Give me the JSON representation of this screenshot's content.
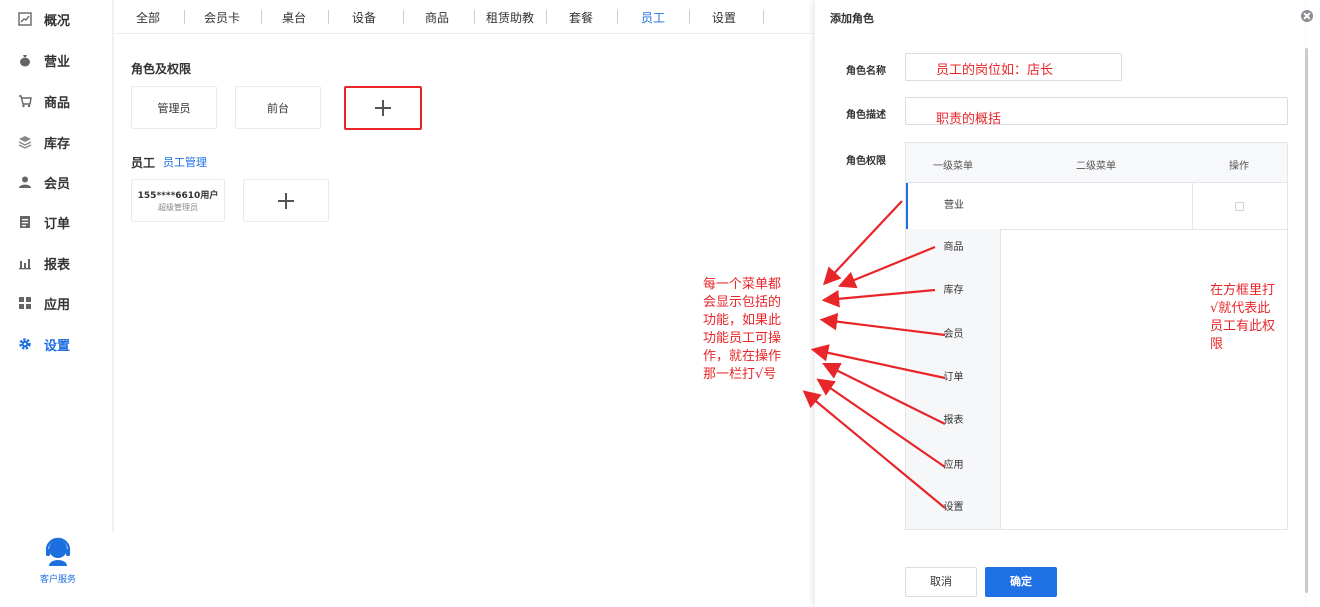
{
  "sidebar": {
    "items": [
      {
        "label": "概况",
        "icon": "chart-line-icon"
      },
      {
        "label": "营业",
        "icon": "money-bag-icon"
      },
      {
        "label": "商品",
        "icon": "cart-icon"
      },
      {
        "label": "库存",
        "icon": "stack-icon"
      },
      {
        "label": "会员",
        "icon": "user-icon"
      },
      {
        "label": "订单",
        "icon": "order-icon"
      },
      {
        "label": "报表",
        "icon": "bar-chart-icon"
      },
      {
        "label": "应用",
        "icon": "grid-icon"
      },
      {
        "label": "设置",
        "icon": "gear-icon",
        "active": true
      }
    ],
    "customer_service": "客户服务"
  },
  "tabs": [
    "全部",
    "会员卡",
    "桌台",
    "设备",
    "商品",
    "租赁助教",
    "套餐",
    "员工",
    "设置"
  ],
  "active_tab": "员工",
  "main": {
    "roles_title": "角色及权限",
    "roles": [
      "管理员",
      "前台"
    ],
    "staff_title": "员工",
    "staff_link": "员工管理",
    "staff_card": {
      "name": "155****6610用户",
      "role": "超级管理员"
    },
    "annotation": [
      "每一个菜单都",
      "会显示包括的",
      "功能，如果此",
      "功能员工可操",
      "作，就在操作",
      "那一栏打√号"
    ]
  },
  "dialog": {
    "title": "添加角色",
    "name_label": "角色名称",
    "name_value": "员工的岗位如：店长",
    "desc_label": "角色描述",
    "desc_value": "职责的概括",
    "perm_label": "角色权限",
    "table_headers": [
      "一级菜单",
      "二级菜单",
      "操作"
    ],
    "menu_items": [
      "营业",
      "商品",
      "库存",
      "会员",
      "订单",
      "报表",
      "应用",
      "设置"
    ],
    "annotation": [
      "在方框里打",
      "√就代表此",
      "员工有此权",
      "限"
    ],
    "cancel_label": "取消",
    "ok_label": "确定"
  },
  "colors": {
    "accent": "#1d6fe0",
    "annotation": "#e8262a"
  }
}
